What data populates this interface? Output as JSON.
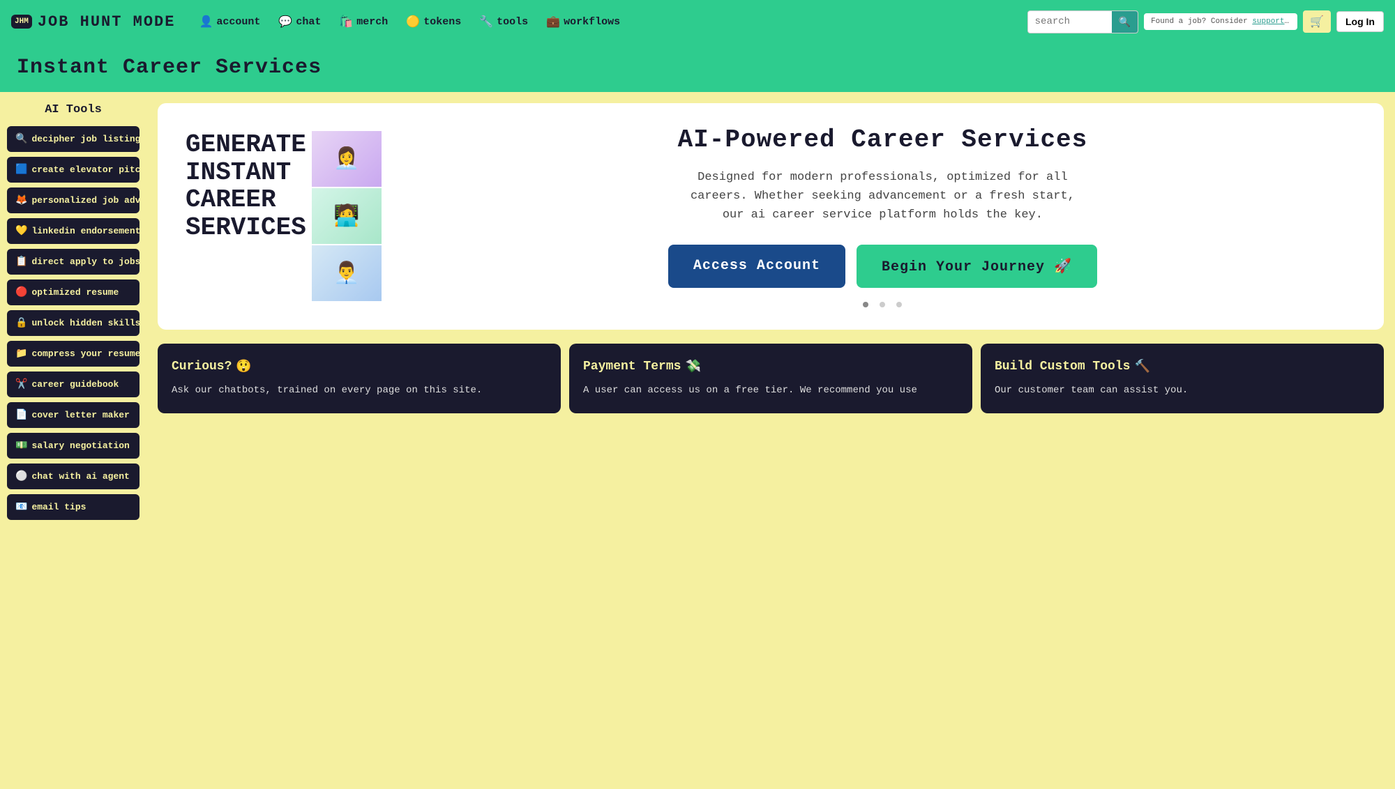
{
  "logo": {
    "badge": "JHM",
    "text": "JOB  HUNT  MODE"
  },
  "nav": {
    "links": [
      {
        "label": "account",
        "icon": "👤",
        "name": "account"
      },
      {
        "label": "chat",
        "icon": "💬",
        "name": "chat"
      },
      {
        "label": "merch",
        "icon": "🛍️",
        "name": "merch"
      },
      {
        "label": "tokens",
        "icon": "🟡",
        "name": "tokens"
      },
      {
        "label": "tools",
        "icon": "🔧",
        "name": "tools"
      },
      {
        "label": "workflows",
        "icon": "💼",
        "name": "workflows"
      }
    ],
    "search_placeholder": "search",
    "supporting_text": "Found a job? Consider",
    "supporting_link": "supporting the site",
    "login_label": "Log In"
  },
  "banner": {
    "title": "Instant Career Services"
  },
  "sidebar": {
    "title": "AI Tools",
    "items": [
      {
        "label": "decipher job listings",
        "emoji": "🔍",
        "name": "decipher-job-listings"
      },
      {
        "label": "create elevator pitch",
        "emoji": "🟦",
        "name": "create-elevator-pitch"
      },
      {
        "label": "personalized job advice",
        "emoji": "🦊",
        "name": "personalized-job-advice"
      },
      {
        "label": "linkedin endorsements",
        "emoji": "💛",
        "name": "linkedin-endorsements"
      },
      {
        "label": "direct apply to jobs",
        "emoji": "📋",
        "name": "direct-apply-to-jobs"
      },
      {
        "label": "optimized resume",
        "emoji": "🔴",
        "name": "optimized-resume"
      },
      {
        "label": "unlock hidden skills",
        "emoji": "🔒",
        "name": "unlock-hidden-skills"
      },
      {
        "label": "compress your resume",
        "emoji": "📁",
        "name": "compress-your-resume"
      },
      {
        "label": "career guidebook",
        "emoji": "✂️",
        "name": "career-guidebook"
      },
      {
        "label": "cover letter maker",
        "emoji": "📄",
        "name": "cover-letter-maker"
      },
      {
        "label": "salary negotiation",
        "emoji": "💵",
        "name": "salary-negotiation"
      },
      {
        "label": "chat with ai agent",
        "emoji": "⚪",
        "name": "chat-with-ai-agent"
      },
      {
        "label": "email tips",
        "emoji": "📧",
        "name": "email-tips"
      }
    ]
  },
  "hero": {
    "left_text_line1": "GENERATE",
    "left_text_line2": "INSTANT",
    "left_text_line3": "CAREER",
    "left_text_line4": "SERVICES",
    "title": "AI-Powered Career Services",
    "description": "Designed for modern professionals, optimized for all careers. Whether seeking advancement or a fresh start, our ai career service platform holds the key.",
    "access_btn": "Access Account",
    "journey_btn": "Begin Your Journey 🚀",
    "illus_icons": [
      "👩‍💻",
      "🧑‍💻",
      "👨‍💻"
    ]
  },
  "info_cards": [
    {
      "title": "Curious?",
      "title_emoji": "😲",
      "body": "Ask our chatbots, trained on every page on this site."
    },
    {
      "title": "Payment Terms",
      "title_emoji": "💸",
      "body": "A user can access us on a free tier. We recommend you use"
    },
    {
      "title": "Build Custom Tools",
      "title_emoji": "🔨",
      "body": "Our customer team can assist you."
    }
  ]
}
